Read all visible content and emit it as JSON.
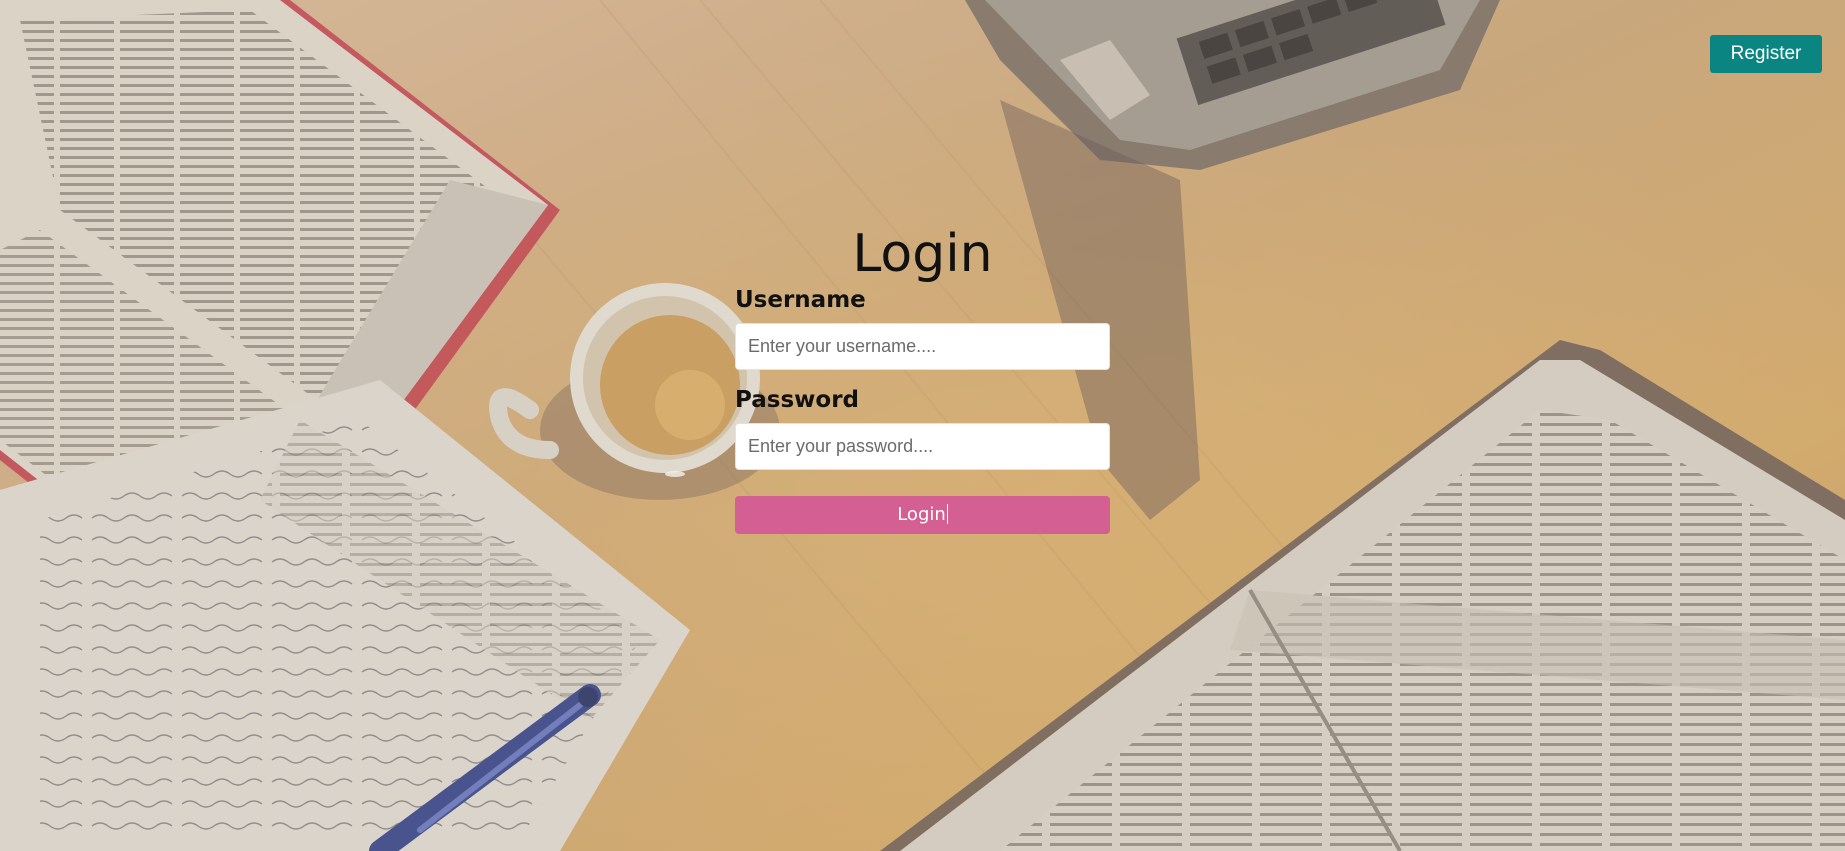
{
  "header": {
    "register_label": "Register"
  },
  "login_form": {
    "title": "Login",
    "username": {
      "label": "Username",
      "value": "",
      "placeholder": "Enter your username...."
    },
    "password": {
      "label": "Password",
      "value": "",
      "placeholder": "Enter your password...."
    },
    "submit_label": "Login"
  },
  "colors": {
    "register_button": "#0b8582",
    "login_button": "#d35f93",
    "input_background": "#ffffff",
    "text": "#111111"
  },
  "icons": {
    "background": "desk-with-books-coffee-laptop-photo"
  }
}
